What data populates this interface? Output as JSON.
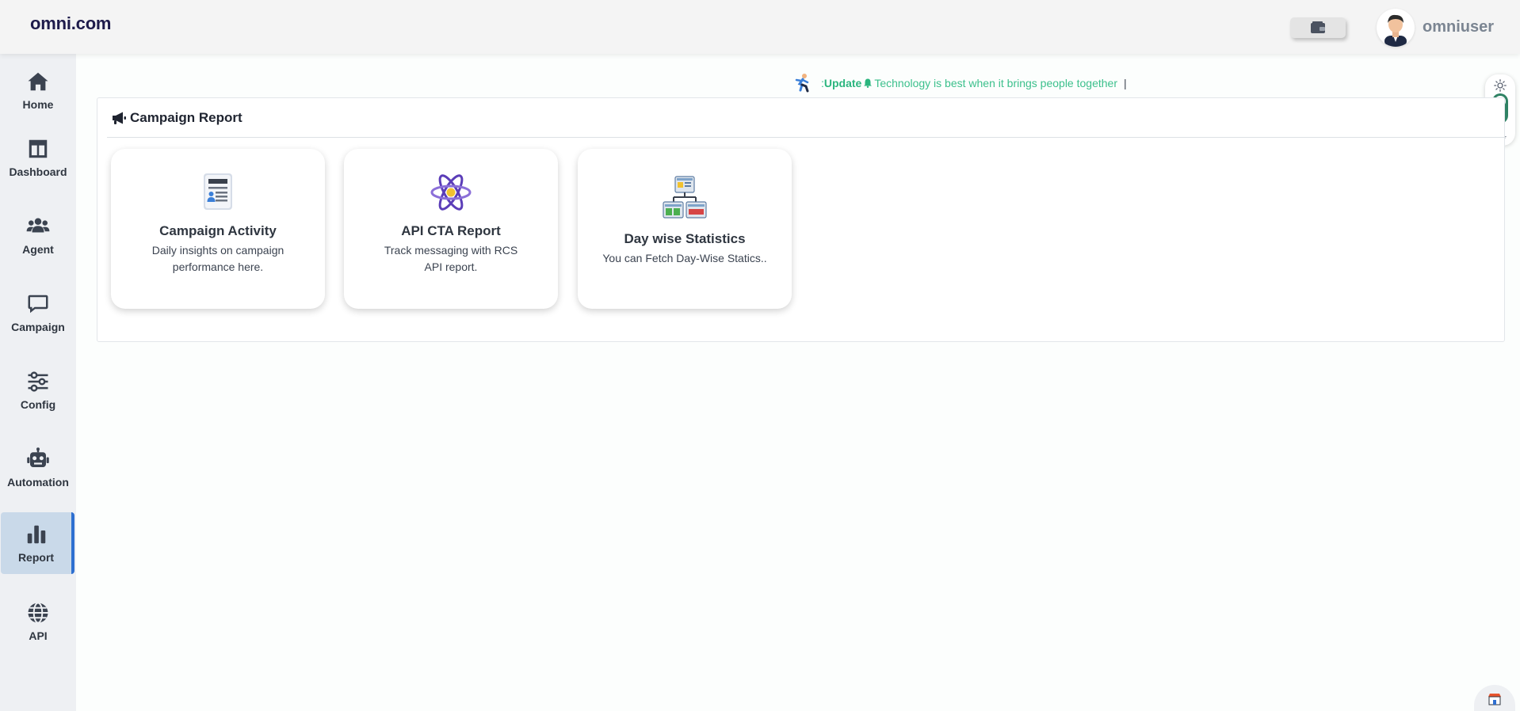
{
  "header": {
    "logo": "omni.com",
    "username": "omniuser"
  },
  "sidebar": {
    "items": [
      {
        "label": "Home",
        "icon": "home-icon"
      },
      {
        "label": "Dashboard",
        "icon": "dashboard-icon"
      },
      {
        "label": "Agent",
        "icon": "users-icon"
      },
      {
        "label": "Campaign",
        "icon": "chat-icon"
      },
      {
        "label": "Config",
        "icon": "sliders-icon"
      },
      {
        "label": "Automation",
        "icon": "robot-icon"
      },
      {
        "label": "Report",
        "icon": "bar-chart-icon",
        "active": true
      },
      {
        "label": "API",
        "icon": "globe-icon"
      }
    ]
  },
  "ticker": {
    "prefix": ": ",
    "label": "Update",
    "message": "Technology is best when it brings people together",
    "caret": "|"
  },
  "panel": {
    "title": "Campaign Report"
  },
  "cards": [
    {
      "title": "Campaign Activity",
      "description": "Daily insights on campaign performance here.",
      "icon": "report-document-icon"
    },
    {
      "title": "API CTA Report",
      "description": "Track messaging with RCS API report.",
      "icon": "atom-icon"
    },
    {
      "title": "Day wise Statistics",
      "description": "You can Fetch Day-Wise Statics..",
      "icon": "sitemap-icon"
    }
  ],
  "colors": {
    "accent": "#2d6fd0",
    "ticker_green": "#3cc08c",
    "toggle_green": "#2f8264",
    "sidebar_bg": "#eef0f3",
    "active_bg": "#c9d9e9"
  }
}
